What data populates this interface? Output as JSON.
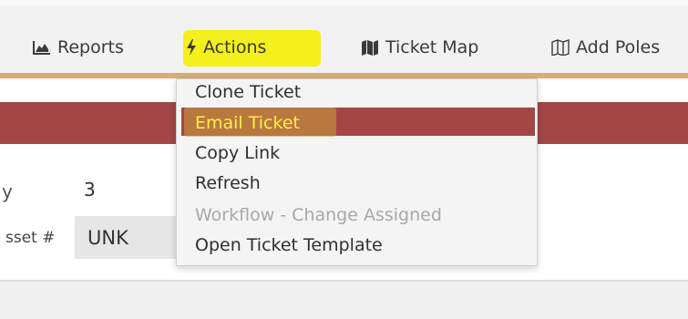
{
  "navbar": {
    "items": [
      {
        "label": "Reports",
        "icon": "area-chart-icon"
      },
      {
        "label": "Actions",
        "icon": "lightning-bolt-icon"
      },
      {
        "label": "Ticket Map",
        "icon": "map-icon"
      },
      {
        "label": "Add Poles",
        "icon": "map-outline-icon"
      }
    ],
    "accent_color": "#d7ad78",
    "highlight_color": "#f3f01c"
  },
  "banner": {
    "color": "#a54646"
  },
  "form": {
    "partial_label": "y",
    "count_value": "3",
    "asset_label": "sset #",
    "asset_value": "UNK"
  },
  "actions_menu": {
    "items": [
      {
        "label": "Clone Ticket",
        "enabled": true
      },
      {
        "label": "Email Ticket",
        "enabled": true,
        "active": true
      },
      {
        "label": "Copy Link",
        "enabled": true
      },
      {
        "label": "Refresh",
        "enabled": true
      },
      {
        "label": "Workflow - Change Assigned",
        "enabled": false
      },
      {
        "label": "Open Ticket Template",
        "enabled": true
      }
    ],
    "active_color": "#a54646"
  }
}
